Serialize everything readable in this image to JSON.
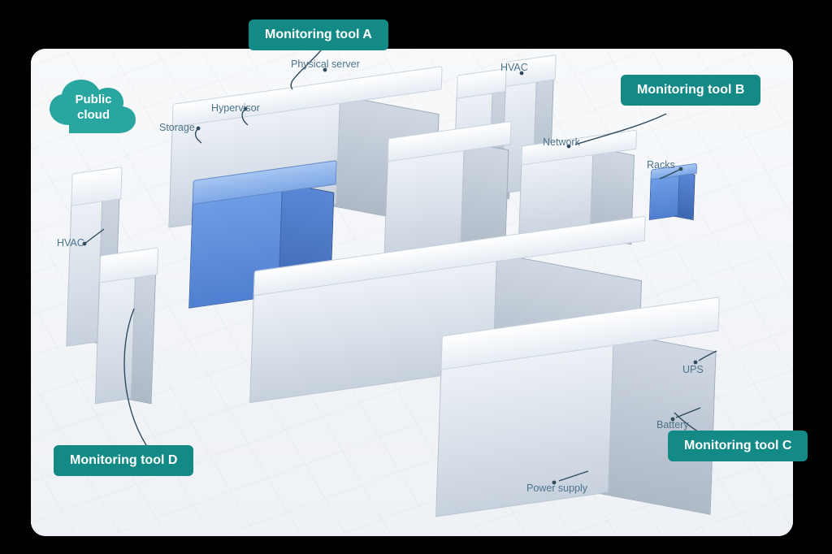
{
  "cloud": {
    "label_l1": "Public",
    "label_l2": "cloud"
  },
  "tags": {
    "a": "Monitoring tool A",
    "b": "Monitoring tool B",
    "c": "Monitoring tool C",
    "d": "Monitoring tool D"
  },
  "labels": {
    "physical_server": "Physical server",
    "hvac_top": "HVAC",
    "hypervisor": "Hypervisor",
    "storage": "Storage",
    "network": "Network",
    "racks": "Racks",
    "hvac_left": "HVAC",
    "ups": "UPS",
    "battery": "Battery",
    "power_supply": "Power supply"
  },
  "colors": {
    "accent": "#148a86",
    "cloud": "#2aa6a1",
    "blue_box": "#4f7fd0"
  }
}
